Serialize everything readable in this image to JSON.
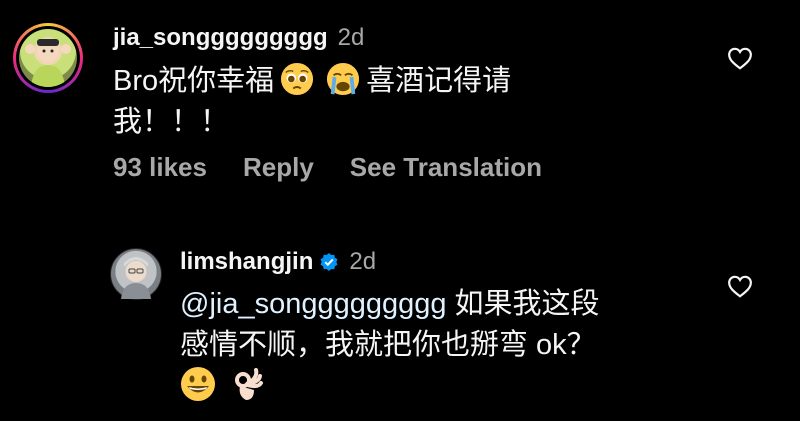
{
  "comment": {
    "username": "jia_songgggggggg",
    "time": "2d",
    "text_line1": "Bro祝你幸福",
    "emoji1": "pleading-face",
    "emoji2": "loudly-crying-face",
    "text_after_emoji": "喜酒记得请",
    "text_line2": "我！！！",
    "likes": "93 likes",
    "reply": "Reply",
    "translate": "See Translation"
  },
  "reply": {
    "username": "limshangjin",
    "time": "2d",
    "mention": "@jia_songgggggggg",
    "text_line1_rest": " 如果我这段",
    "text_line2": "感情不顺，我就把你也掰弯 ok？",
    "emoji1": "grinning-face",
    "emoji2": "ok-hand"
  },
  "colors": {
    "background": "#000000",
    "text": "#f5f5f5",
    "muted": "#a8a8a8",
    "verified": "#0095f6"
  }
}
